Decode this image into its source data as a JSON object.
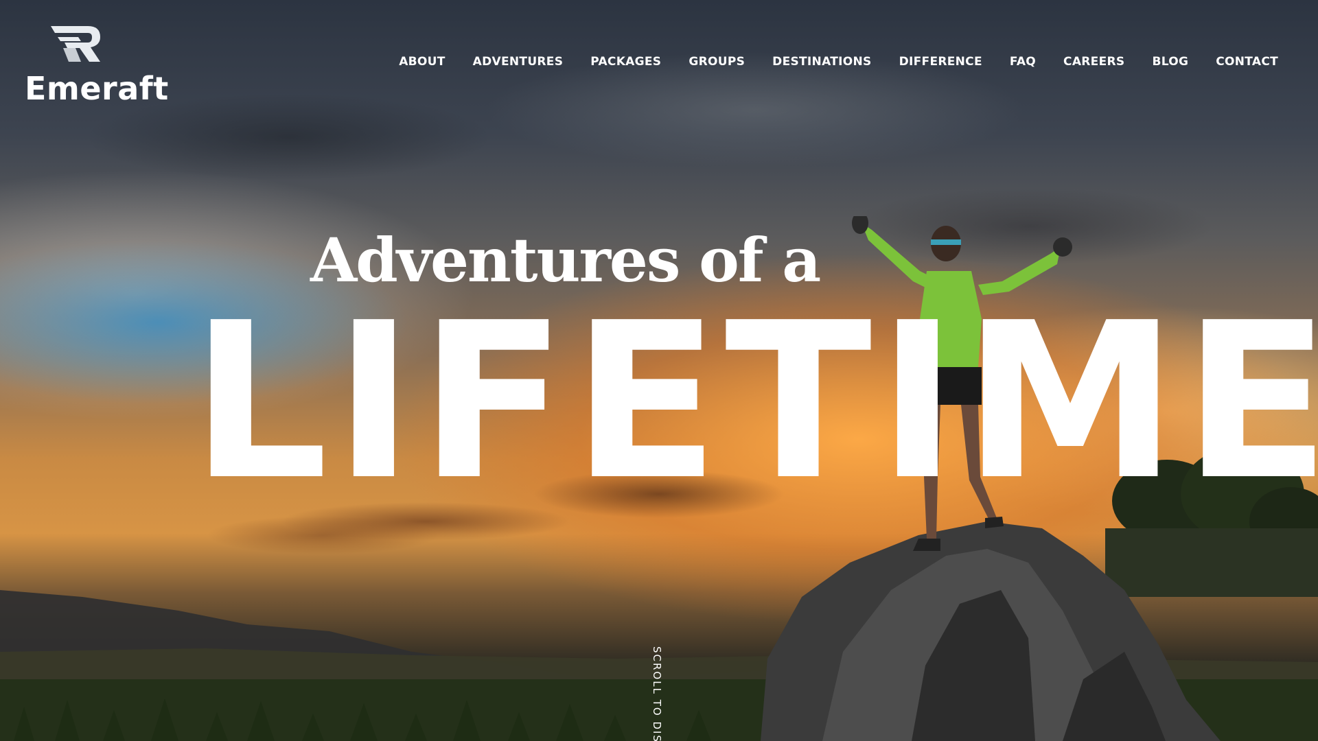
{
  "brand": {
    "name": "Emeraft",
    "logo_icon": "emeraft-r-logo-icon"
  },
  "nav": {
    "items": [
      {
        "label": "ABOUT"
      },
      {
        "label": "ADVENTURES"
      },
      {
        "label": "PACKAGES"
      },
      {
        "label": "GROUPS"
      },
      {
        "label": "DESTINATIONS"
      },
      {
        "label": "DIFFERENCE"
      },
      {
        "label": "FAQ"
      },
      {
        "label": "CAREERS"
      },
      {
        "label": "BLOG"
      },
      {
        "label": "CONTACT"
      }
    ]
  },
  "hero": {
    "tagline": "Adventures of a",
    "headline": "LIFETIME",
    "scroll_cue": "SCROLL TO DISCOVER"
  },
  "colors": {
    "text": "#ffffff",
    "jacket": "#7cc23a",
    "sky_orange": "#d79445"
  }
}
